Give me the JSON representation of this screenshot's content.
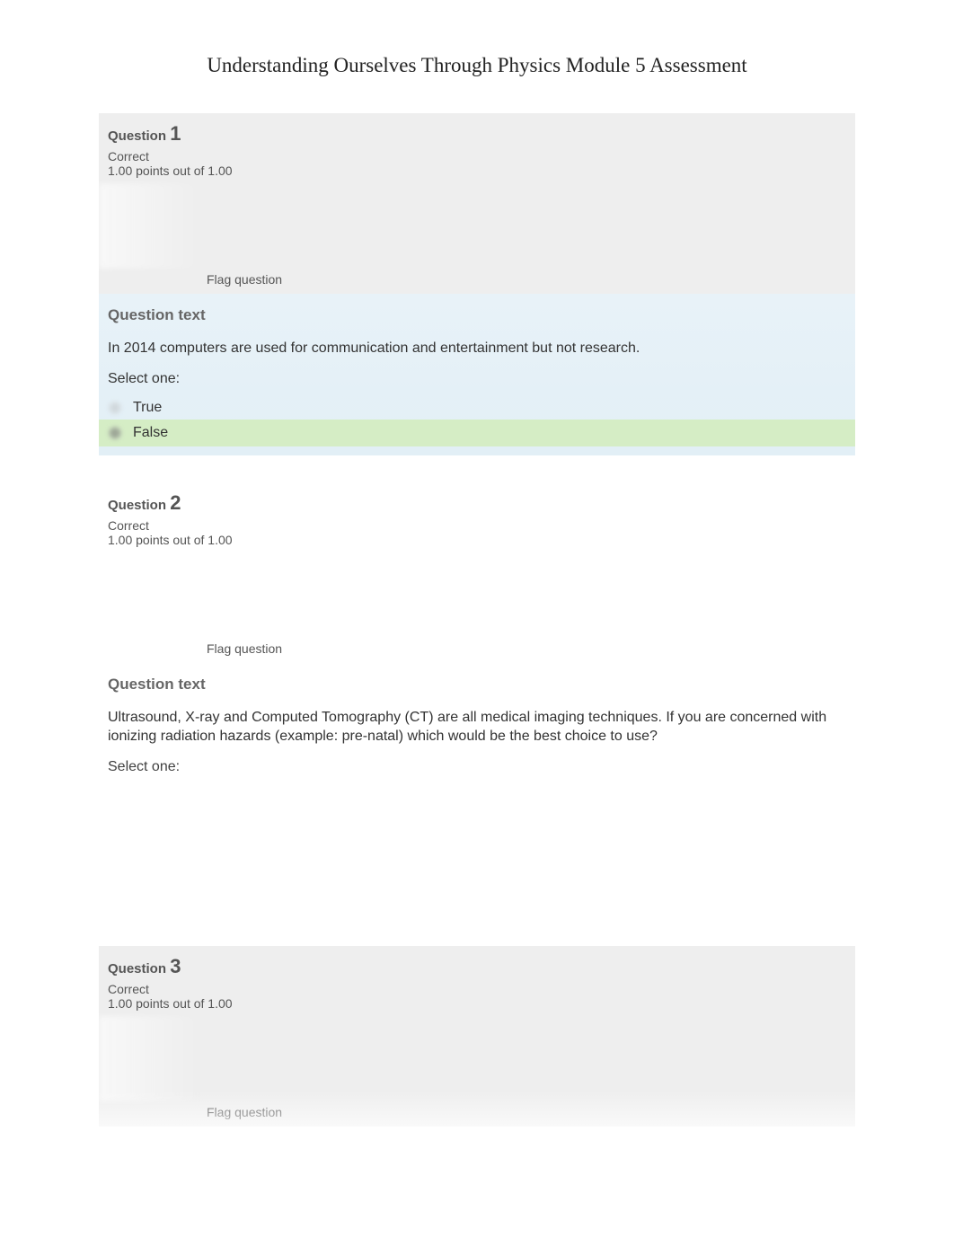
{
  "page": {
    "title": "Understanding Ourselves Through Physics Module 5 Assessment"
  },
  "questions": [
    {
      "label": "Question",
      "number": "1",
      "status": "Correct",
      "points": "1.00 points out of 1.00",
      "flag": "Flag question",
      "textHeading": "Question text",
      "prompt": "In 2014 computers are used for communication and entertainment but not research.",
      "selectOne": "Select one:",
      "options": [
        {
          "label": "True",
          "selected": false
        },
        {
          "label": "False",
          "selected": true
        }
      ]
    },
    {
      "label": "Question",
      "number": "2",
      "status": "Correct",
      "points": "1.00 points out of 1.00",
      "flag": "Flag question",
      "textHeading": "Question text",
      "prompt": "Ultrasound, X-ray and Computed Tomography (CT) are all medical imaging techniques. If you are concerned with ionizing radiation hazards (example: pre-natal) which would be the best choice to use?",
      "selectOne": "Select one:"
    },
    {
      "label": "Question",
      "number": "3",
      "status": "Correct",
      "points": "1.00 points out of 1.00",
      "flag": "Flag question"
    }
  ]
}
